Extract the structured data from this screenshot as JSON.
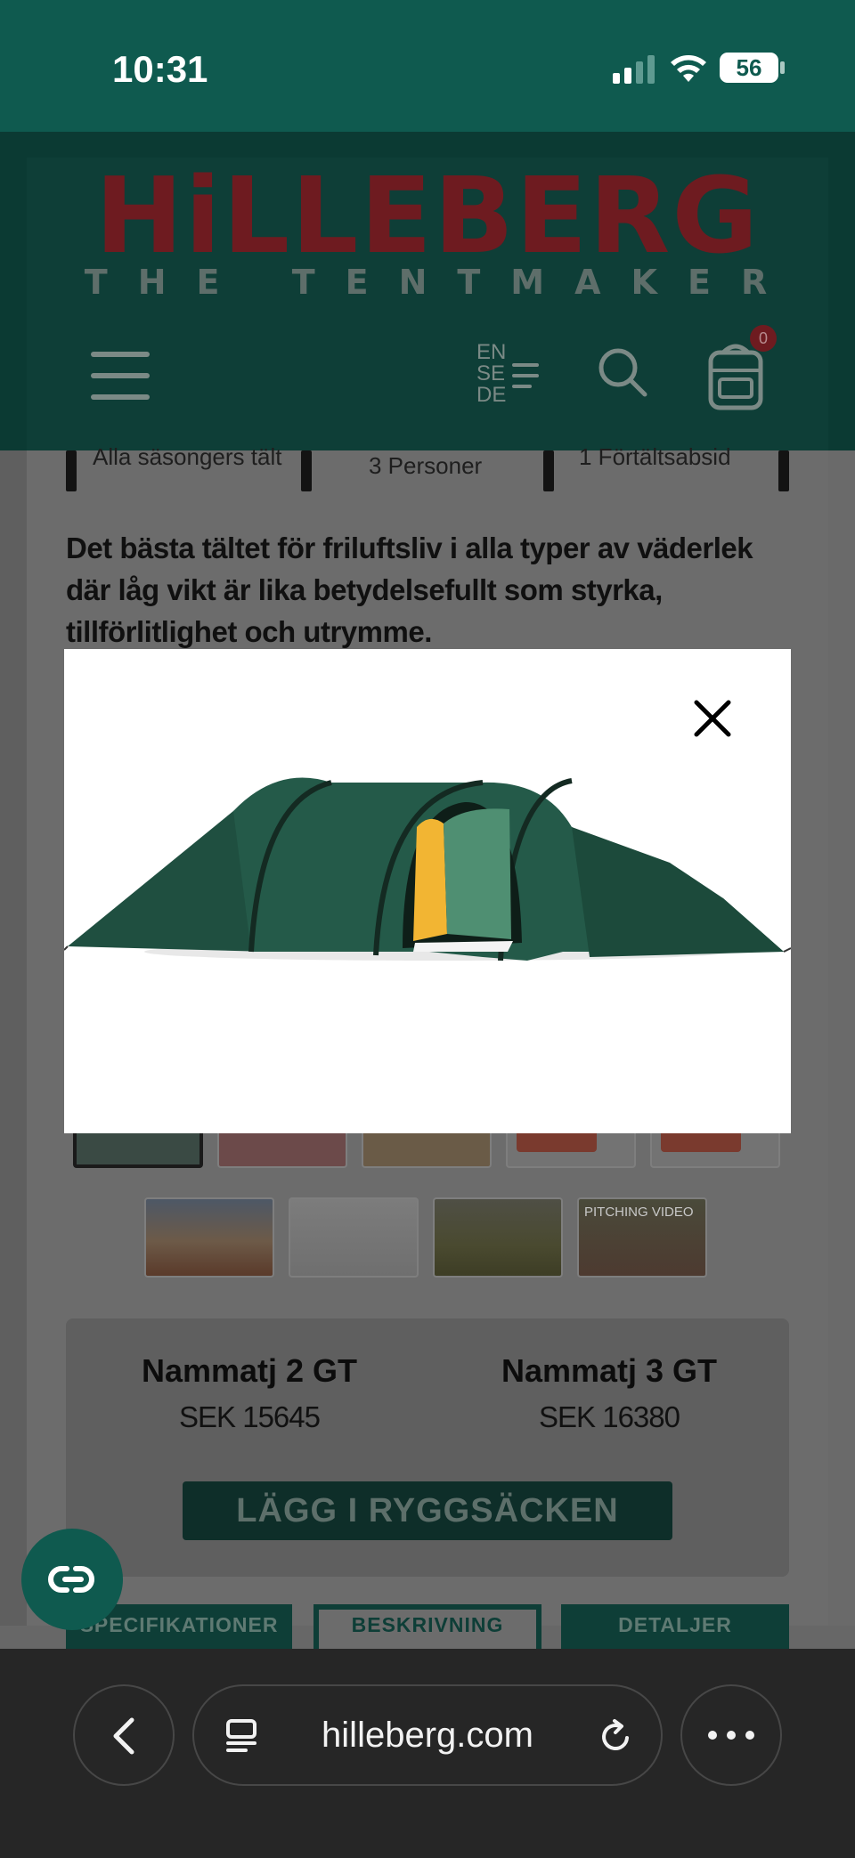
{
  "status_bar": {
    "time": "10:31",
    "battery": "56"
  },
  "header": {
    "logo": "HiLLEBERG",
    "tagline": "THE TENTMAKER",
    "languages": [
      "EN",
      "SE",
      "DE"
    ],
    "cart_count": "0"
  },
  "features": [
    {
      "label": "Alla säsongers tält"
    },
    {
      "label": "3 Personer"
    },
    {
      "label": "1 Förtältsabsid"
    }
  ],
  "intro_text": "Det bästa tältet för friluftsliv i alla typer av väderlek där låg vikt är lika betydelsefullt som styrka, tillförlitlighet och utrymme.",
  "gallery": {
    "video_label": "PITCHING VIDEO"
  },
  "compare": {
    "models": [
      {
        "name": "Nammatj 2 GT",
        "price": "SEK 15645"
      },
      {
        "name": "Nammatj 3 GT",
        "price": "SEK 16380"
      }
    ],
    "add_button": "LÄGG I RYGGSÄCKEN"
  },
  "tabs": [
    "SPECIFIKATIONER",
    "BESKRIVNING",
    "DETALJER"
  ],
  "browser": {
    "url": "hilleberg.com"
  },
  "colors": {
    "brand_green": "#0f5a4f",
    "brand_red": "#6e1b20",
    "tent_green": "#1e4d3d",
    "tent_inner_yellow": "#f2b533"
  },
  "icons": [
    "menu-icon",
    "language-icon",
    "search-icon",
    "backpack-cart-icon",
    "close-icon",
    "chat-icon",
    "back-icon",
    "reader-icon",
    "reload-icon",
    "more-icon"
  ]
}
